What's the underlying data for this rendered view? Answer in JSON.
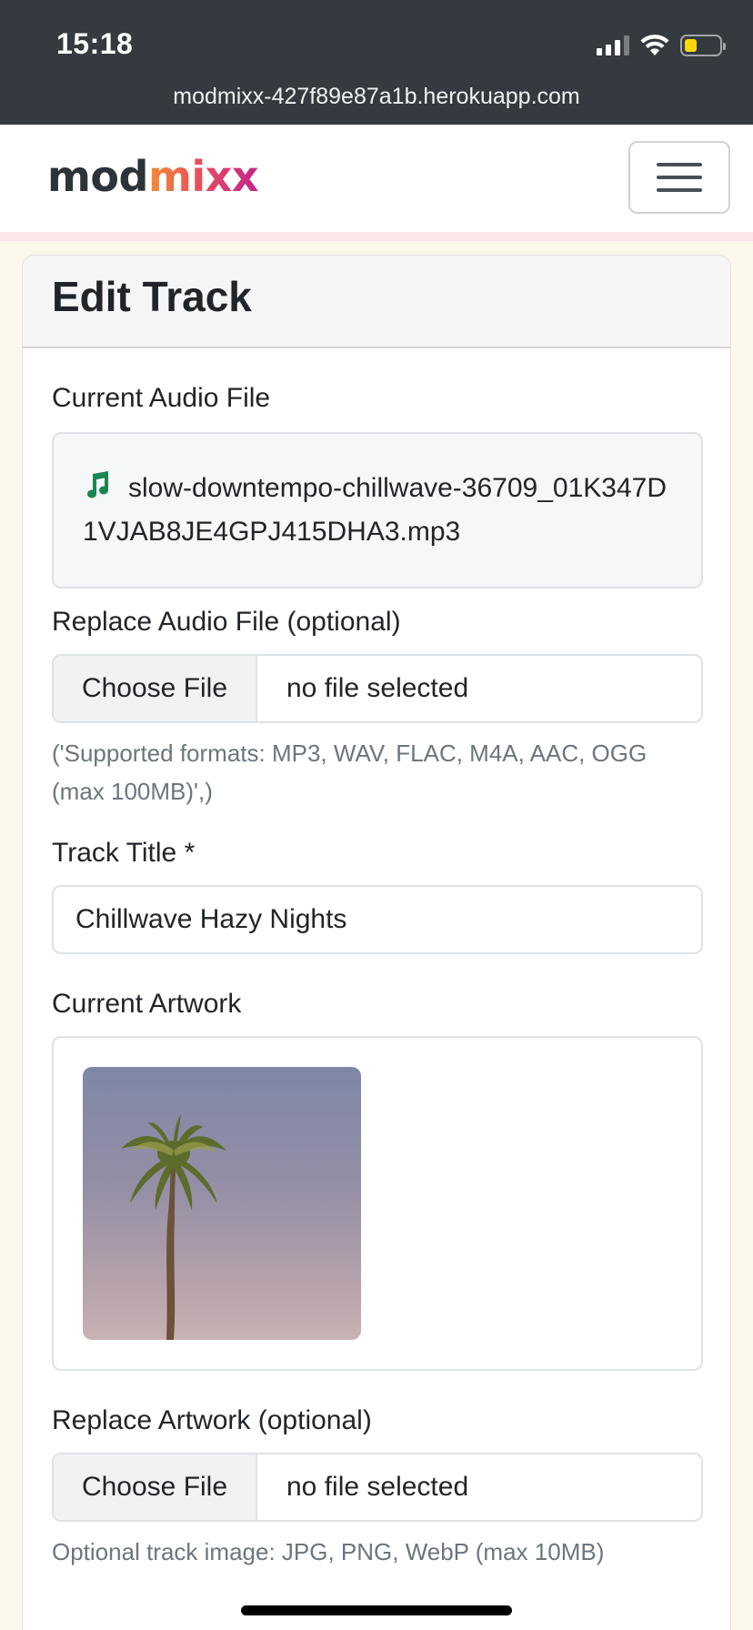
{
  "status_bar": {
    "time": "15:18",
    "url": "modmixx-427f89e87a1b.herokuapp.com",
    "battery_level": 0.35,
    "battery_color": "#ffd60a"
  },
  "navbar": {
    "brand_part1": "mod",
    "brand_part2": "mixx",
    "toggler_icon": "hamburger-menu-icon"
  },
  "page": {
    "title": "Edit Track"
  },
  "form": {
    "current_audio_label": "Current Audio File",
    "current_audio_file": "slow-downtempo-chillwave-36709_01K347D1VJAB8JE4GPJ415DHA3.mp3",
    "audio_icon": "music-note-icon",
    "audio_icon_color": "#198754",
    "replace_audio_label": "Replace Audio File (optional)",
    "replace_audio_button": "Choose File",
    "replace_audio_status": "no file selected",
    "replace_audio_help": "('Supported formats: MP3, WAV, FLAC, M4A, AAC, OGG (max 100MB)',)",
    "track_title_label": "Track Title *",
    "track_title_value": "Chillwave Hazy Nights",
    "current_artwork_label": "Current Artwork",
    "artwork_description_icon": "palm-tree-artwork",
    "replace_artwork_label": "Replace Artwork (optional)",
    "replace_artwork_button": "Choose File",
    "replace_artwork_status": "no file selected",
    "replace_artwork_help": "Optional track image: JPG, PNG, WebP (max 10MB)"
  }
}
